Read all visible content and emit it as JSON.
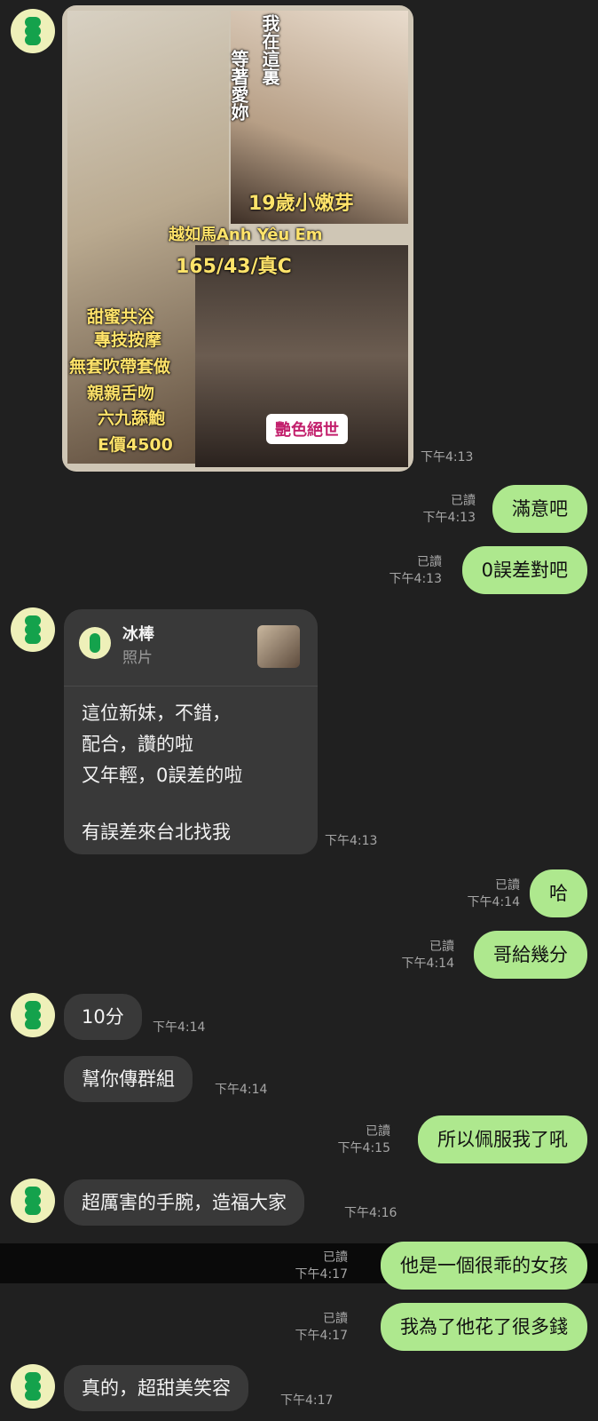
{
  "photo_captions": {
    "top_right": "我在這裏",
    "waiting": "等著愛妳",
    "age": "19歲小嫩芽",
    "name": "越如馬Anh Yêu Em",
    "stats": "165/43/真C",
    "list": [
      "甜蜜共浴",
      "專技按摩",
      "無套吹帶套做",
      "親親舌吻",
      "六九舔鮑",
      "E價4500"
    ],
    "brand": "艷色絕世"
  },
  "messages": [
    {
      "side": "in",
      "time": "下午4:13"
    },
    {
      "side": "out",
      "text": "滿意吧",
      "read": "已讀",
      "time": "下午4:13"
    },
    {
      "side": "out",
      "text": "0誤差對吧",
      "read": "已讀",
      "time": "下午4:13"
    },
    {
      "side": "in",
      "time": "下午4:13"
    },
    {
      "side": "out",
      "text": "哈",
      "read": "已讀",
      "time": "下午4:14"
    },
    {
      "side": "out",
      "text": "哥給幾分",
      "read": "已讀",
      "time": "下午4:14"
    },
    {
      "side": "in",
      "text": "10分",
      "time": "下午4:14"
    },
    {
      "side": "in",
      "text": "幫你傳群組",
      "time": "下午4:14"
    },
    {
      "side": "out",
      "text": "所以佩服我了吼",
      "read": "已讀",
      "time": "下午4:15"
    },
    {
      "side": "in",
      "text": "超厲害的手腕，造福大家",
      "time": "下午4:16"
    },
    {
      "side": "out",
      "text": "他是一個很乖的女孩",
      "read": "已讀",
      "time": "下午4:17"
    },
    {
      "side": "out",
      "text": "我為了他花了很多錢",
      "read": "已讀",
      "time": "下午4:17"
    },
    {
      "side": "in",
      "text": "真的，超甜美笑容",
      "time": "下午4:17"
    }
  ],
  "reply_card": {
    "name": "冰棒",
    "type": "照片",
    "lines": [
      "這位新妹，不錯，",
      "配合，讚的啦",
      "又年輕，0誤差的啦",
      "",
      "有誤差來台北找我"
    ]
  },
  "colors": {
    "background": "#202020",
    "incoming": "#393939",
    "outgoing": "#aee88e"
  }
}
